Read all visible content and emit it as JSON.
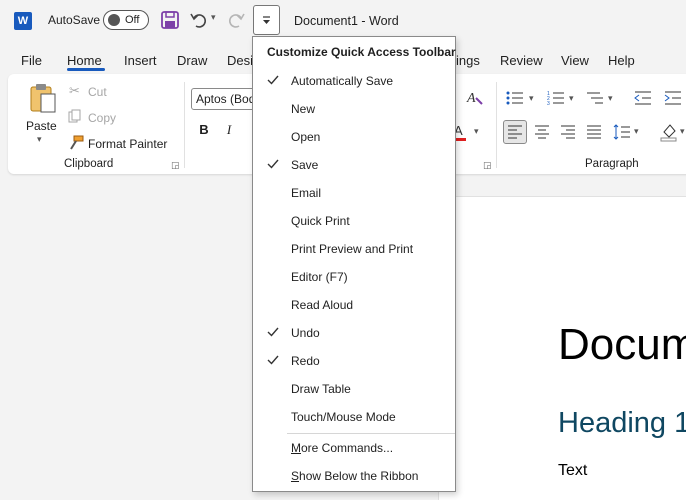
{
  "titlebar": {
    "app_icon_letter": "W",
    "autosave_label": "AutoSave",
    "autosave_state": "Off",
    "document_title": "Document1  -  Word"
  },
  "tabs": [
    {
      "label": "File"
    },
    {
      "label": "Home",
      "active": true
    },
    {
      "label": "Insert"
    },
    {
      "label": "Draw"
    },
    {
      "label": "Desi"
    },
    {
      "label": "ings"
    },
    {
      "label": "Review"
    },
    {
      "label": "View"
    },
    {
      "label": "Help"
    }
  ],
  "ribbon": {
    "clipboard": {
      "paste_label": "Paste",
      "cut_label": "Cut",
      "copy_label": "Copy",
      "format_painter_label": "Format Painter",
      "group_label": "Clipboard"
    },
    "font": {
      "font_name": "Aptos (Bod",
      "bold": "B",
      "italic": "I"
    },
    "paragraph": {
      "group_label": "Paragraph"
    }
  },
  "menu": {
    "header": "Customize Quick Access Toolbar",
    "items": [
      {
        "label": "Automatically Save",
        "checked": true
      },
      {
        "label": "New",
        "checked": false
      },
      {
        "label": "Open",
        "checked": false
      },
      {
        "label": "Save",
        "checked": true
      },
      {
        "label": "Email",
        "checked": false
      },
      {
        "label": "Quick Print",
        "checked": false
      },
      {
        "label": "Print Preview and Print",
        "checked": false
      },
      {
        "label": "Editor (F7)",
        "checked": false
      },
      {
        "label": "Read Aloud",
        "checked": false
      },
      {
        "label": "Undo",
        "checked": true
      },
      {
        "label": "Redo",
        "checked": true
      },
      {
        "label": "Draw Table",
        "checked": false
      },
      {
        "label": "Touch/Mouse Mode",
        "checked": false
      }
    ],
    "more_commands": {
      "underline_char": "M",
      "rest": "ore Commands..."
    },
    "show_below": {
      "underline_char": "S",
      "rest": "how Below the Ribbon"
    }
  },
  "document": {
    "title_text": "Docum",
    "heading1_text": "Heading 1",
    "body_text": "Text"
  },
  "colors": {
    "accent": "#185abd",
    "save_icon": "#7c3fa8",
    "heading1": "#0f4761"
  }
}
